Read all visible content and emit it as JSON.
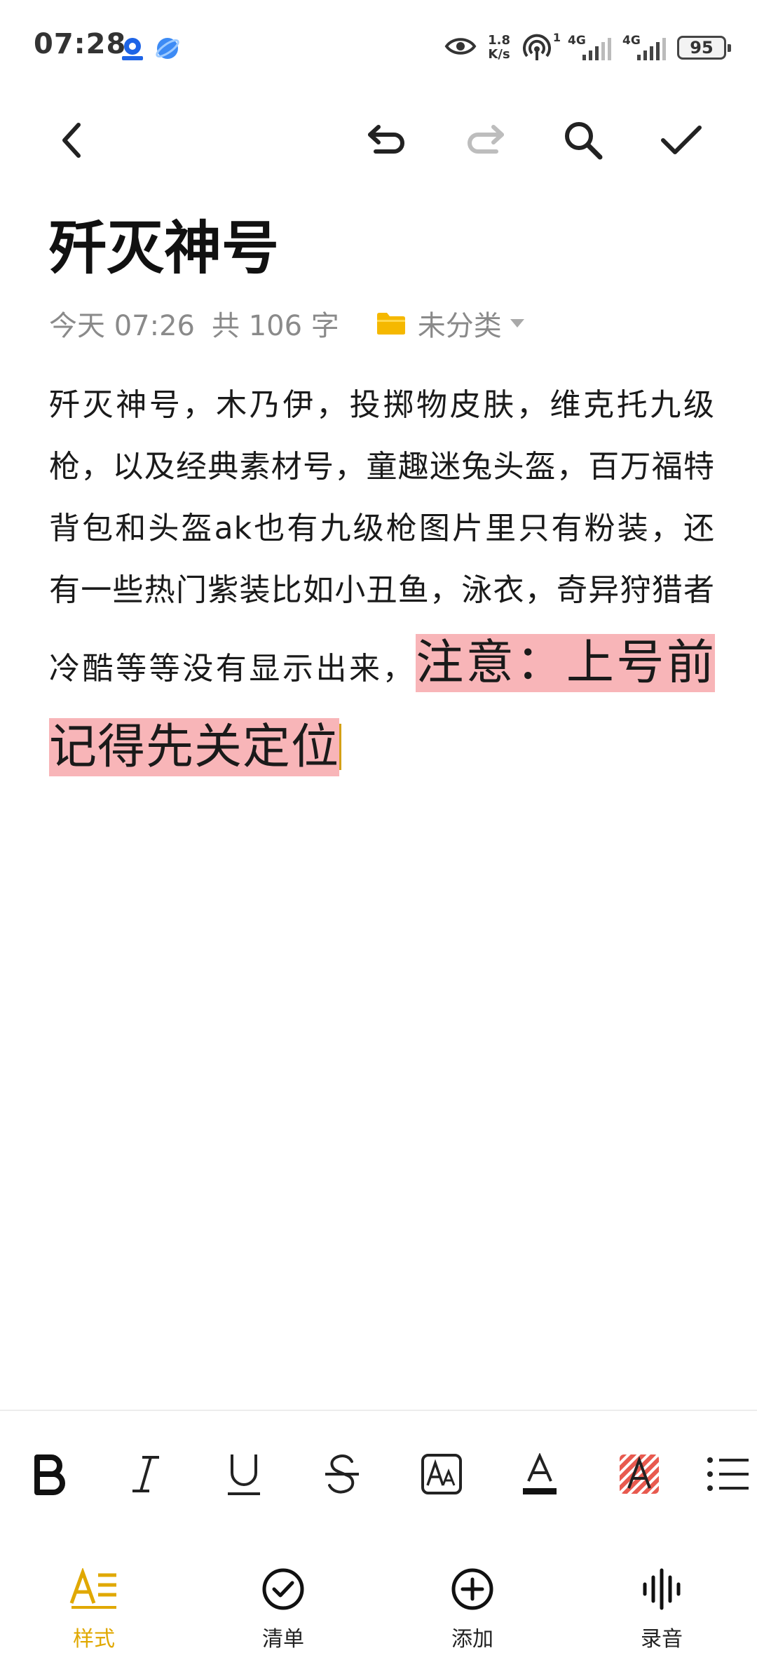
{
  "status_bar": {
    "time": "07:28",
    "net_speed_value": "1.8",
    "net_speed_unit": "K/s",
    "sim1_net": "4G",
    "sim1_slot": "1",
    "sim2_net": "4G",
    "battery": "95"
  },
  "note": {
    "title": "歼灭神号",
    "date": "今天 07:26",
    "word_count": "共 106 字",
    "folder": "未分类",
    "body_text": "歼灭神号，木乃伊，投掷物皮肤，维克托九级枪，以及经典素材号，童趣迷兔头盔，百万福特背包和头盔ak也有九级枪图片里只有粉装，还有一些热门紫装比如小丑鱼，泳衣，奇异狩猎者冷酷等等没有显示出来，",
    "highlight_text": "注意：上号前记得先关定位"
  },
  "colors": {
    "accent": "#e0a800",
    "highlight": "#f8b5b8",
    "folder": "#f5b800",
    "disabled": "#bdbdbd"
  },
  "format_bar": {
    "items": [
      "bold-icon",
      "italic-icon",
      "underline-icon",
      "strikethrough-icon",
      "font-size-icon",
      "text-color-icon",
      "highlight-color-icon",
      "list-icon"
    ]
  },
  "bottom_nav": {
    "items": [
      {
        "label": "样式",
        "icon": "style-icon",
        "active": true
      },
      {
        "label": "清单",
        "icon": "checklist-icon",
        "active": false
      },
      {
        "label": "添加",
        "icon": "add-icon",
        "active": false
      },
      {
        "label": "录音",
        "icon": "voice-icon",
        "active": false
      }
    ]
  }
}
